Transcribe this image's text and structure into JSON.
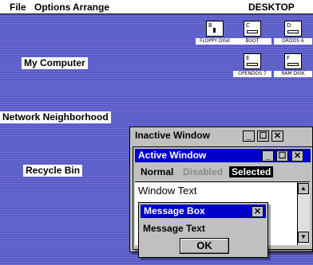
{
  "menubar": {
    "file": "File",
    "options": "Options",
    "arrange": "Arrange",
    "desktop": "DESKTOP"
  },
  "desktop_icons": {
    "my_computer": "My Computer",
    "network": "Network Neighborhood",
    "recycle": "Recycle Bin"
  },
  "drives": [
    {
      "letter": "B",
      "label": "FLOPPY DISK"
    },
    {
      "letter": "C",
      "label": "BOOT"
    },
    {
      "letter": "D",
      "label": "DRDOS 6"
    },
    {
      "letter": "E",
      "label": "OPENDOS 7"
    },
    {
      "letter": "F",
      "label": "RAM DISK"
    }
  ],
  "inactive_window": {
    "title": "Inactive Window"
  },
  "active_window": {
    "title": "Active Window",
    "tab_normal": "Normal",
    "tab_disabled": "Disabled",
    "tab_selected": "Selected",
    "body_text": "Window Text"
  },
  "message_box": {
    "title": "Message Box",
    "text": "Message Text",
    "ok_label": "OK"
  },
  "glyphs": {
    "minimize": "_",
    "maximize": "☐",
    "close": "✕",
    "up": "▲",
    "down": "▼"
  },
  "colors": {
    "desktop": "#5a5cc9",
    "active_title": "#0000c8",
    "inactive_title": "#c0c0c0",
    "selected_tab": "#000000"
  }
}
